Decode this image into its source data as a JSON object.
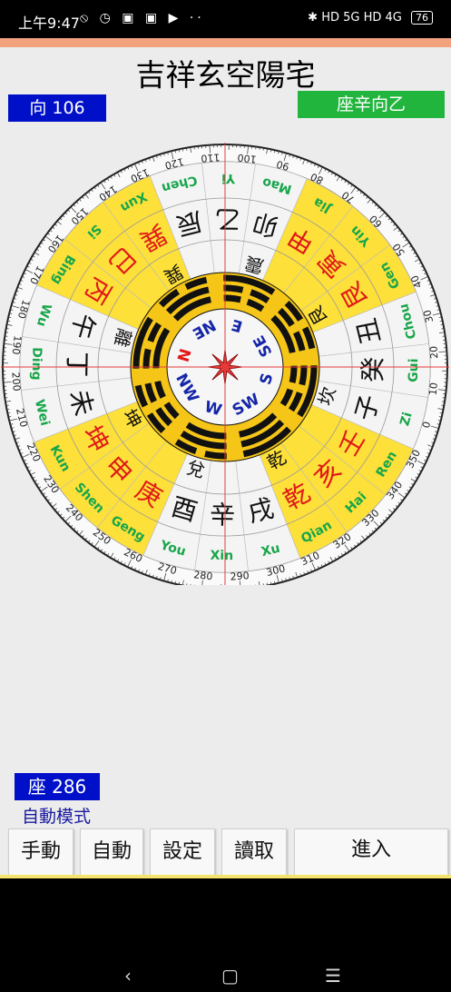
{
  "status_bar": {
    "time": "上午9:47",
    "signal_text": "HD 5G HD 4G",
    "battery": "76"
  },
  "app": {
    "title": "吉祥玄空陽宅",
    "direction_label": "向 106",
    "mountain_label": "座辛向乙",
    "sitting_label": "座 286",
    "mode_label": "自動模式",
    "buttons": {
      "manual": "手動",
      "auto": "自動",
      "settings": "設定",
      "read": "讀取",
      "enter": "進入"
    }
  },
  "compass": {
    "degree_labels": [
      "0",
      "10",
      "20",
      "30",
      "40",
      "50",
      "60",
      "70",
      "80",
      "90",
      "100",
      "110",
      "120",
      "130",
      "140",
      "150",
      "160",
      "170",
      "180",
      "190",
      "200",
      "210",
      "220",
      "230",
      "240",
      "250",
      "260",
      "270",
      "280",
      "290",
      "300",
      "310",
      "320",
      "330",
      "340",
      "350"
    ],
    "mountains": [
      {
        "cn": "子",
        "py": "Zi",
        "hl": false
      },
      {
        "cn": "癸",
        "py": "Gui",
        "hl": false
      },
      {
        "cn": "丑",
        "py": "Chou",
        "hl": false
      },
      {
        "cn": "艮",
        "py": "Gen",
        "hl": true
      },
      {
        "cn": "寅",
        "py": "Yin",
        "hl": true
      },
      {
        "cn": "甲",
        "py": "Jia",
        "hl": true
      },
      {
        "cn": "卯",
        "py": "Mao",
        "hl": false
      },
      {
        "cn": "乙",
        "py": "Yi",
        "hl": false
      },
      {
        "cn": "辰",
        "py": "Chen",
        "hl": false
      },
      {
        "cn": "巽",
        "py": "Xun",
        "hl": true
      },
      {
        "cn": "巳",
        "py": "Si",
        "hl": true
      },
      {
        "cn": "丙",
        "py": "Bing",
        "hl": true
      },
      {
        "cn": "午",
        "py": "Wu",
        "hl": false
      },
      {
        "cn": "丁",
        "py": "Ding",
        "hl": false
      },
      {
        "cn": "未",
        "py": "Wei",
        "hl": false
      },
      {
        "cn": "坤",
        "py": "Kun",
        "hl": true
      },
      {
        "cn": "申",
        "py": "Shen",
        "hl": true
      },
      {
        "cn": "庚",
        "py": "Geng",
        "hl": true
      },
      {
        "cn": "酉",
        "py": "You",
        "hl": false
      },
      {
        "cn": "辛",
        "py": "Xin",
        "hl": false
      },
      {
        "cn": "戌",
        "py": "Xu",
        "hl": false
      },
      {
        "cn": "乾",
        "py": "Qian",
        "hl": true
      },
      {
        "cn": "亥",
        "py": "Hai",
        "hl": true
      },
      {
        "cn": "壬",
        "py": "Ren",
        "hl": true
      }
    ],
    "trigrams": [
      "坎",
      "艮",
      "震",
      "巽",
      "離",
      "坤",
      "兌",
      "乾"
    ],
    "directions": [
      "S",
      "SE",
      "E",
      "NE",
      "N",
      "NW",
      "W",
      "SW"
    ],
    "colors": {
      "highlight": "#fde03a",
      "pinyin": "#17a64a",
      "red_text": "#e01818",
      "ring_black": "#111111",
      "ring_yellow": "#f5c518",
      "dir_blue": "#1626a8",
      "crosshair": "#e63a3a"
    }
  }
}
